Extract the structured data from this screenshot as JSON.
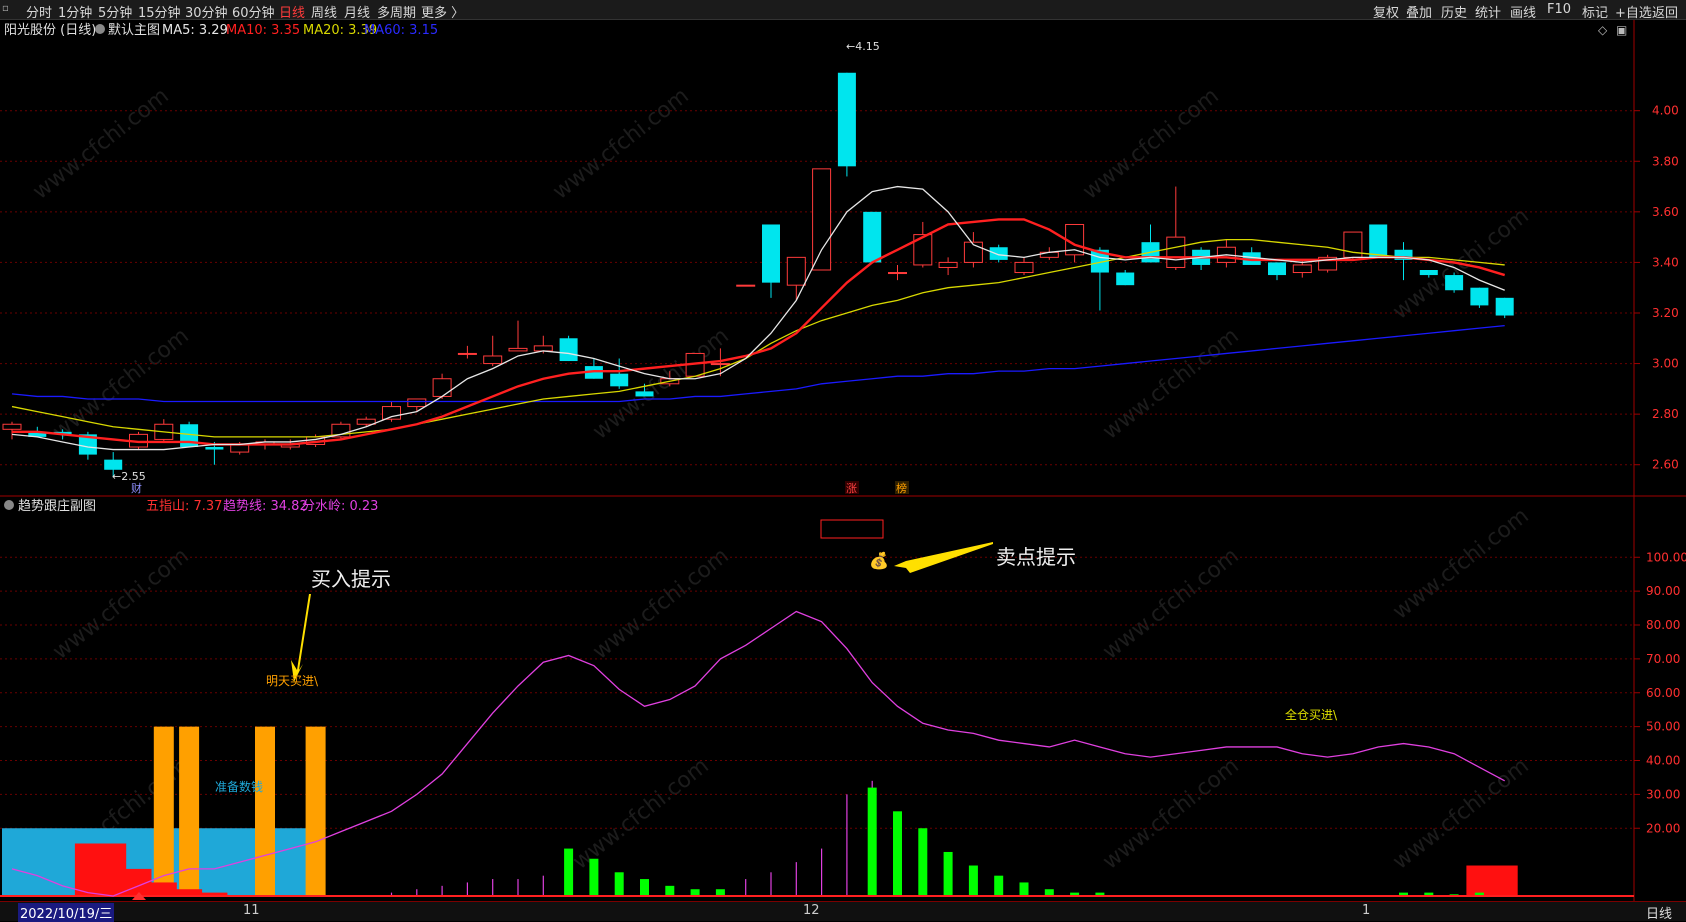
{
  "toolbar": {
    "tabs": [
      "分时",
      "1分钟",
      "5分钟",
      "15分钟",
      "30分钟",
      "60分钟",
      "日线",
      "周线",
      "月线",
      "多周期",
      "更多 〉"
    ],
    "active_tab": "日线",
    "right_buttons": [
      "复权",
      "叠加",
      "历史",
      "统计",
      "画线",
      "F10",
      "标记",
      "+自选",
      "返回"
    ]
  },
  "main_header": {
    "stock": "阳光股份 (日线)",
    "template": "默认主图",
    "ma5": "MA5: 3.29",
    "ma10": "MA10: 3.35",
    "ma20": "MA20: 3.39",
    "ma60": "MA60: 3.15"
  },
  "sub_header": {
    "name": "趋势跟庄副图",
    "v1": "五指山: 7.37",
    "v2": "趋势线: 34.82",
    "v3": "分水岭: 0.23"
  },
  "annotations": {
    "buy_hint": "买入提示",
    "sell_hint": "卖点提示",
    "buy_tomorrow": "明天买进\\",
    "full_buy": "全仓买进\\",
    "prepare": "准备数钱",
    "high_label": "4.15",
    "low_label": "2.55",
    "cai": "财",
    "zhang": "涨",
    "bang": "榜"
  },
  "bottom": {
    "date": "2022/10/19/三",
    "month_labels": [
      "11",
      "12",
      "1"
    ],
    "period": "日线"
  },
  "colors": {
    "up": "#ff3b3b",
    "down": "#00e5ee",
    "ma5": "#e6e6e6",
    "ma10": "#ff2020",
    "ma20": "#d8d800",
    "ma60": "#1a1aff",
    "trend": "#e040e0",
    "green_bar": "#00ff00",
    "orange_bar": "#ffa000",
    "blue_zone": "#1fa8d8"
  },
  "chart_data": [
    {
      "type": "candlestick",
      "ylim": [
        2.5,
        4.24
      ],
      "y_ticks": [
        2.6,
        2.8,
        3.0,
        3.2,
        3.4,
        3.6,
        3.8,
        4.0
      ],
      "ohlc": [
        [
          2.74,
          2.77,
          2.7,
          2.76
        ],
        [
          2.73,
          2.75,
          2.71,
          2.71
        ],
        [
          2.73,
          2.74,
          2.7,
          2.72
        ],
        [
          2.72,
          2.73,
          2.62,
          2.64
        ],
        [
          2.62,
          2.65,
          2.55,
          2.58
        ],
        [
          2.67,
          2.73,
          2.66,
          2.72
        ],
        [
          2.7,
          2.78,
          2.69,
          2.76
        ],
        [
          2.76,
          2.77,
          2.67,
          2.67
        ],
        [
          2.67,
          2.69,
          2.6,
          2.66
        ],
        [
          2.65,
          2.69,
          2.64,
          2.68
        ],
        [
          2.68,
          2.7,
          2.66,
          2.69
        ],
        [
          2.67,
          2.7,
          2.66,
          2.68
        ],
        [
          2.68,
          2.72,
          2.67,
          2.71
        ],
        [
          2.71,
          2.77,
          2.7,
          2.76
        ],
        [
          2.76,
          2.79,
          2.75,
          2.78
        ],
        [
          2.78,
          2.85,
          2.77,
          2.83
        ],
        [
          2.83,
          2.86,
          2.81,
          2.86
        ],
        [
          2.87,
          2.96,
          2.86,
          2.94
        ],
        [
          3.04,
          3.07,
          3.02,
          3.04
        ],
        [
          3.0,
          3.11,
          2.99,
          3.03
        ],
        [
          3.05,
          3.17,
          3.05,
          3.06
        ],
        [
          3.05,
          3.11,
          3.04,
          3.07
        ],
        [
          3.1,
          3.11,
          3.01,
          3.01
        ],
        [
          2.99,
          3.02,
          2.94,
          2.94
        ],
        [
          2.96,
          3.02,
          2.9,
          2.91
        ],
        [
          2.89,
          2.92,
          2.87,
          2.87
        ],
        [
          2.92,
          2.97,
          2.91,
          2.94
        ],
        [
          2.95,
          3.04,
          2.95,
          3.04
        ],
        [
          3.0,
          3.06,
          2.95,
          3.0
        ],
        [
          3.31,
          3.31,
          3.31,
          3.31
        ],
        [
          3.55,
          3.55,
          3.26,
          3.32
        ],
        [
          3.31,
          3.42,
          3.25,
          3.42
        ],
        [
          3.37,
          3.77,
          3.37,
          3.77
        ],
        [
          4.15,
          4.15,
          3.74,
          3.78
        ],
        [
          3.6,
          3.6,
          3.4,
          3.4
        ],
        [
          3.36,
          3.39,
          3.33,
          3.36
        ],
        [
          3.39,
          3.56,
          3.38,
          3.51
        ],
        [
          3.38,
          3.42,
          3.35,
          3.4
        ],
        [
          3.4,
          3.52,
          3.38,
          3.48
        ],
        [
          3.46,
          3.47,
          3.4,
          3.41
        ],
        [
          3.36,
          3.42,
          3.35,
          3.4
        ],
        [
          3.42,
          3.46,
          3.41,
          3.44
        ],
        [
          3.43,
          3.55,
          3.4,
          3.55
        ],
        [
          3.45,
          3.46,
          3.21,
          3.36
        ],
        [
          3.36,
          3.37,
          3.31,
          3.31
        ],
        [
          3.48,
          3.55,
          3.4,
          3.4
        ],
        [
          3.38,
          3.7,
          3.37,
          3.5
        ],
        [
          3.45,
          3.46,
          3.37,
          3.39
        ],
        [
          3.4,
          3.49,
          3.38,
          3.46
        ],
        [
          3.44,
          3.46,
          3.4,
          3.39
        ],
        [
          3.4,
          3.4,
          3.33,
          3.35
        ],
        [
          3.36,
          3.41,
          3.34,
          3.39
        ],
        [
          3.37,
          3.43,
          3.36,
          3.42
        ],
        [
          3.42,
          3.52,
          3.41,
          3.52
        ],
        [
          3.55,
          3.55,
          3.42,
          3.42
        ],
        [
          3.45,
          3.48,
          3.33,
          3.41
        ],
        [
          3.37,
          3.37,
          3.34,
          3.35
        ],
        [
          3.35,
          3.36,
          3.28,
          3.29
        ],
        [
          3.3,
          3.3,
          3.22,
          3.23
        ],
        [
          3.26,
          3.26,
          3.18,
          3.19
        ]
      ],
      "ma5": [
        2.72,
        2.71,
        2.69,
        2.67,
        2.66,
        2.66,
        2.66,
        2.67,
        2.68,
        2.68,
        2.69,
        2.69,
        2.7,
        2.72,
        2.75,
        2.79,
        2.81,
        2.87,
        2.94,
        2.98,
        3.03,
        3.05,
        3.04,
        3.02,
        2.99,
        2.96,
        2.94,
        2.94,
        2.96,
        3.02,
        3.12,
        3.25,
        3.45,
        3.6,
        3.68,
        3.7,
        3.69,
        3.6,
        3.47,
        3.43,
        3.42,
        3.44,
        3.45,
        3.42,
        3.41,
        3.42,
        3.41,
        3.42,
        3.43,
        3.42,
        3.41,
        3.4,
        3.41,
        3.42,
        3.42,
        3.42,
        3.41,
        3.38,
        3.33,
        3.29
      ],
      "ma10": [
        2.73,
        2.73,
        2.72,
        2.71,
        2.7,
        2.69,
        2.69,
        2.69,
        2.68,
        2.68,
        2.68,
        2.68,
        2.69,
        2.7,
        2.72,
        2.74,
        2.76,
        2.79,
        2.83,
        2.87,
        2.91,
        2.94,
        2.96,
        2.97,
        2.97,
        2.98,
        2.99,
        3.0,
        3.01,
        3.03,
        3.06,
        3.12,
        3.22,
        3.32,
        3.4,
        3.45,
        3.5,
        3.55,
        3.56,
        3.57,
        3.57,
        3.53,
        3.47,
        3.44,
        3.42,
        3.42,
        3.42,
        3.42,
        3.42,
        3.41,
        3.41,
        3.41,
        3.41,
        3.41,
        3.42,
        3.42,
        3.41,
        3.4,
        3.38,
        3.35
      ],
      "ma20": [
        2.83,
        2.81,
        2.79,
        2.77,
        2.75,
        2.74,
        2.73,
        2.72,
        2.71,
        2.71,
        2.71,
        2.71,
        2.71,
        2.72,
        2.73,
        2.74,
        2.76,
        2.78,
        2.8,
        2.82,
        2.84,
        2.86,
        2.87,
        2.88,
        2.89,
        2.91,
        2.93,
        2.95,
        2.98,
        3.02,
        3.08,
        3.13,
        3.17,
        3.2,
        3.23,
        3.25,
        3.28,
        3.3,
        3.31,
        3.32,
        3.34,
        3.36,
        3.38,
        3.4,
        3.42,
        3.44,
        3.46,
        3.48,
        3.49,
        3.49,
        3.48,
        3.47,
        3.46,
        3.44,
        3.43,
        3.42,
        3.42,
        3.41,
        3.4,
        3.39
      ],
      "ma60": [
        2.88,
        2.87,
        2.87,
        2.86,
        2.86,
        2.86,
        2.85,
        2.85,
        2.85,
        2.85,
        2.85,
        2.85,
        2.85,
        2.85,
        2.85,
        2.85,
        2.85,
        2.85,
        2.85,
        2.85,
        2.85,
        2.85,
        2.85,
        2.85,
        2.85,
        2.86,
        2.86,
        2.87,
        2.87,
        2.88,
        2.89,
        2.9,
        2.92,
        2.93,
        2.94,
        2.95,
        2.95,
        2.96,
        2.96,
        2.97,
        2.97,
        2.98,
        2.98,
        2.99,
        3.0,
        3.01,
        3.02,
        3.03,
        3.04,
        3.05,
        3.06,
        3.07,
        3.08,
        3.09,
        3.1,
        3.11,
        3.12,
        3.13,
        3.14,
        3.15
      ]
    },
    {
      "type": "indicator",
      "ylim": [
        0,
        111
      ],
      "y_ticks": [
        20,
        30,
        40,
        50,
        60,
        70,
        80,
        90,
        100
      ],
      "trend_line": [
        8,
        6,
        3,
        1,
        0,
        3,
        6,
        8,
        8,
        10,
        12,
        14,
        16,
        19,
        22,
        25,
        30,
        36,
        45,
        54,
        62,
        69,
        71,
        68,
        61,
        56,
        58,
        62,
        70,
        74,
        79,
        84,
        81,
        73,
        63,
        56,
        51,
        49,
        48,
        46,
        45,
        44,
        46,
        44,
        42,
        41,
        42,
        43,
        44,
        44,
        44,
        42,
        41,
        42,
        44,
        45,
        44,
        42,
        38,
        34
      ],
      "green_bars": [
        0,
        0,
        0,
        0,
        0,
        0,
        0,
        0,
        0,
        0,
        0,
        0,
        0,
        0,
        0,
        0,
        0,
        0,
        0,
        0,
        0,
        0,
        14,
        11,
        7,
        5,
        3,
        2,
        2,
        0,
        0,
        0,
        0,
        0,
        32,
        25,
        20,
        13,
        9,
        6,
        4,
        2,
        1,
        1,
        0,
        0,
        0,
        0,
        0,
        0,
        0,
        0,
        0,
        0,
        0,
        1,
        1,
        0.5,
        1,
        0
      ],
      "magenta_bars": [
        0,
        0,
        0,
        0,
        0,
        0,
        0,
        0,
        0,
        0,
        0,
        0,
        0,
        0,
        0,
        1,
        2,
        3,
        4,
        5,
        5,
        6,
        7,
        0,
        0,
        0,
        0,
        0,
        0,
        5,
        7,
        10,
        14,
        30,
        34,
        0,
        0,
        0,
        0,
        0,
        0,
        0,
        0,
        0,
        0,
        0,
        0,
        0,
        0,
        0,
        0,
        0,
        0,
        0,
        0,
        0,
        0,
        0,
        0,
        0
      ],
      "orange_bars": [
        0,
        0,
        0,
        0,
        0,
        0,
        50,
        50,
        0,
        0,
        50,
        0,
        50,
        0,
        0,
        0,
        0,
        0,
        0,
        0,
        0,
        0,
        0,
        0,
        0,
        0,
        0,
        0,
        0,
        0,
        0,
        0,
        0,
        0,
        0,
        0,
        0,
        0,
        0,
        0,
        0,
        0,
        0,
        0,
        0,
        0,
        0,
        0,
        0,
        0,
        0,
        0,
        0,
        0,
        0,
        0,
        0,
        0,
        0,
        0
      ],
      "red_bars": [
        0,
        0,
        0,
        15.5,
        15.5,
        8,
        4,
        2,
        1,
        0,
        0,
        0,
        0,
        0,
        0,
        0,
        0,
        0,
        0,
        0,
        0,
        0,
        0,
        0,
        0,
        0,
        0,
        0,
        0,
        0,
        0,
        0,
        0,
        0,
        0,
        0,
        0,
        0,
        0,
        0,
        0,
        0,
        0,
        0,
        0,
        0,
        0,
        0,
        0,
        0,
        0,
        0,
        0,
        0,
        0,
        0,
        0,
        0,
        9,
        9
      ],
      "blue_zone": {
        "from_index": 0,
        "to_index": 12,
        "value": 20
      }
    }
  ]
}
